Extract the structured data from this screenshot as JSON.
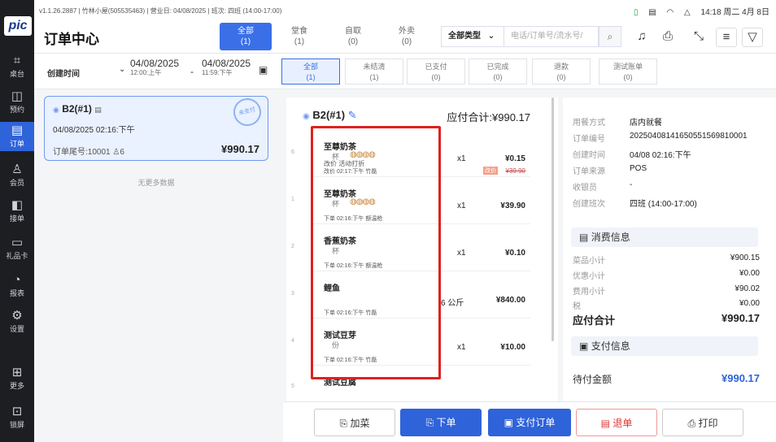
{
  "status": {
    "version": "v1.1.26.2887",
    "store": "竹林小屋(505535463)",
    "business_date": "营业日: 04/08/2025",
    "shift": "班次: 四班 (14:00-17:00)",
    "clock": "14:18 周二 4月 8日"
  },
  "nav": {
    "logo": "pic",
    "items": [
      {
        "label": "桌台",
        "icon": "⌗"
      },
      {
        "label": "预约",
        "icon": "◫"
      },
      {
        "label": "订单",
        "icon": "▤"
      },
      {
        "label": "会员",
        "icon": "♙"
      },
      {
        "label": "接单",
        "icon": "◧"
      },
      {
        "label": "礼品卡",
        "icon": "▭"
      },
      {
        "label": "报表",
        "icon": "◔"
      },
      {
        "label": "设置",
        "icon": "⚙"
      },
      {
        "label": "更多",
        "icon": "⊞"
      },
      {
        "label": "锁屏",
        "icon": "⊡"
      }
    ]
  },
  "header": {
    "title": "订单中心",
    "tabs": [
      {
        "label": "全部",
        "count": "(1)"
      },
      {
        "label": "堂食",
        "count": "(1)"
      },
      {
        "label": "自取",
        "count": "(0)"
      },
      {
        "label": "外卖",
        "count": "(0)"
      }
    ],
    "type_select": "全部类型",
    "search_placeholder": "电话/订单号/流水号/"
  },
  "filter": {
    "label": "创建时间",
    "date_from": "04/08/2025",
    "time_from": "12:00:上午",
    "date_to": "04/08/2025",
    "time_to": "11:59:下午",
    "sep": "-",
    "tabs": [
      {
        "label": "全部",
        "count": "(1)"
      },
      {
        "label": "未结清",
        "count": "(1)"
      },
      {
        "label": "已支付",
        "count": "(0)"
      },
      {
        "label": "已完成",
        "count": "(0)"
      },
      {
        "label": "退款",
        "count": "(0)"
      },
      {
        "label": "测试账单",
        "count": "(0)"
      }
    ]
  },
  "order_card": {
    "table": "B2(#1)",
    "stamp": "未支付",
    "time": "04/08/2025 02:16:下午",
    "tail": "订单尾号:10001",
    "guests": "6",
    "amount": "¥990.17"
  },
  "list_empty": "无更多数据",
  "detail": {
    "table": "B2(#1)",
    "total": "应付合计:¥990.17",
    "items": [
      {
        "idx": "6",
        "name": "至尊奶茶",
        "unit": "杯",
        "dots": "◍◍◍◍",
        "qty": "x1",
        "price": "¥0.15",
        "change": "改价  活动打折",
        "meta": "改价  02:17:下午  竹磊",
        "tag": "改价",
        "orig": "¥39.90"
      },
      {
        "idx": "1",
        "name": "至尊奶茶",
        "unit": "杯",
        "dots": "◍◍◍◍",
        "qty": "x1",
        "price": "¥39.90",
        "meta": "下单  02:16:下午  额温枪"
      },
      {
        "idx": "2",
        "name": "香蕉奶茶",
        "unit": "杯",
        "qty": "x1",
        "price": "¥0.10",
        "meta": "下单  02:16:下午  额温枪"
      },
      {
        "idx": "3",
        "name": "鲤鱼",
        "unit": "",
        "qty": "6 公斤",
        "price": "¥840.00",
        "meta": "下单  02:16:下午  竹磊"
      },
      {
        "idx": "4",
        "name": "测试豆芽",
        "unit": "份",
        "qty": "x1",
        "price": "¥10.00",
        "meta": "下单  02:16:下午  竹磊"
      },
      {
        "idx": "5",
        "name": "测试豆腐",
        "unit": "",
        "qty": "",
        "price": "",
        "meta": ""
      }
    ]
  },
  "info": {
    "rows": [
      {
        "k": "用餐方式",
        "v": "店内就餐"
      },
      {
        "k": "订单编号",
        "v": "20250408141650551569810001"
      },
      {
        "k": "创建时间",
        "v": "04/08 02:16:下午"
      },
      {
        "k": "订单来源",
        "v": "POS"
      },
      {
        "k": "收银员",
        "v": "-"
      },
      {
        "k": "创建班次",
        "v": "四班 (14:00-17:00)"
      }
    ],
    "consume_title": "消费信息",
    "consume": [
      {
        "k": "菜品小计",
        "v": "¥900.15"
      },
      {
        "k": "优惠小计",
        "v": "¥0.00"
      },
      {
        "k": "费用小计",
        "v": "¥90.02"
      },
      {
        "k": "税",
        "v": "¥0.00"
      }
    ],
    "total_label": "应付合计",
    "total_value": "¥990.17",
    "pay_title": "支付信息",
    "due_label": "待付金额",
    "due_value": "¥990.17"
  },
  "footer": {
    "add": "加菜",
    "place": "下单",
    "pay": "支付订单",
    "refund": "退单",
    "print": "打印"
  }
}
